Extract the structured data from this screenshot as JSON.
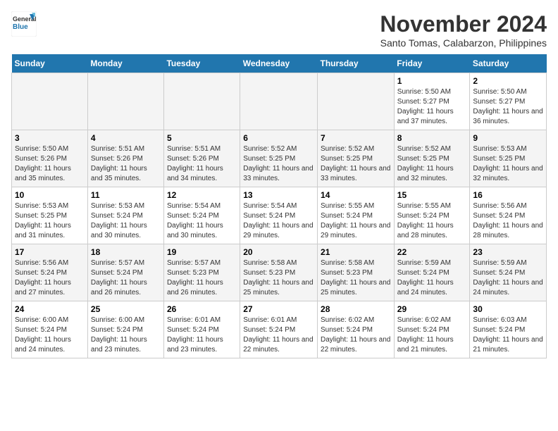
{
  "header": {
    "logo_line1": "General",
    "logo_line2": "Blue",
    "month_year": "November 2024",
    "location": "Santo Tomas, Calabarzon, Philippines"
  },
  "weekdays": [
    "Sunday",
    "Monday",
    "Tuesday",
    "Wednesday",
    "Thursday",
    "Friday",
    "Saturday"
  ],
  "weeks": [
    [
      {
        "day": "",
        "info": ""
      },
      {
        "day": "",
        "info": ""
      },
      {
        "day": "",
        "info": ""
      },
      {
        "day": "",
        "info": ""
      },
      {
        "day": "",
        "info": ""
      },
      {
        "day": "1",
        "info": "Sunrise: 5:50 AM\nSunset: 5:27 PM\nDaylight: 11 hours and 37 minutes."
      },
      {
        "day": "2",
        "info": "Sunrise: 5:50 AM\nSunset: 5:27 PM\nDaylight: 11 hours and 36 minutes."
      }
    ],
    [
      {
        "day": "3",
        "info": "Sunrise: 5:50 AM\nSunset: 5:26 PM\nDaylight: 11 hours and 35 minutes."
      },
      {
        "day": "4",
        "info": "Sunrise: 5:51 AM\nSunset: 5:26 PM\nDaylight: 11 hours and 35 minutes."
      },
      {
        "day": "5",
        "info": "Sunrise: 5:51 AM\nSunset: 5:26 PM\nDaylight: 11 hours and 34 minutes."
      },
      {
        "day": "6",
        "info": "Sunrise: 5:52 AM\nSunset: 5:25 PM\nDaylight: 11 hours and 33 minutes."
      },
      {
        "day": "7",
        "info": "Sunrise: 5:52 AM\nSunset: 5:25 PM\nDaylight: 11 hours and 33 minutes."
      },
      {
        "day": "8",
        "info": "Sunrise: 5:52 AM\nSunset: 5:25 PM\nDaylight: 11 hours and 32 minutes."
      },
      {
        "day": "9",
        "info": "Sunrise: 5:53 AM\nSunset: 5:25 PM\nDaylight: 11 hours and 32 minutes."
      }
    ],
    [
      {
        "day": "10",
        "info": "Sunrise: 5:53 AM\nSunset: 5:25 PM\nDaylight: 11 hours and 31 minutes."
      },
      {
        "day": "11",
        "info": "Sunrise: 5:53 AM\nSunset: 5:24 PM\nDaylight: 11 hours and 30 minutes."
      },
      {
        "day": "12",
        "info": "Sunrise: 5:54 AM\nSunset: 5:24 PM\nDaylight: 11 hours and 30 minutes."
      },
      {
        "day": "13",
        "info": "Sunrise: 5:54 AM\nSunset: 5:24 PM\nDaylight: 11 hours and 29 minutes."
      },
      {
        "day": "14",
        "info": "Sunrise: 5:55 AM\nSunset: 5:24 PM\nDaylight: 11 hours and 29 minutes."
      },
      {
        "day": "15",
        "info": "Sunrise: 5:55 AM\nSunset: 5:24 PM\nDaylight: 11 hours and 28 minutes."
      },
      {
        "day": "16",
        "info": "Sunrise: 5:56 AM\nSunset: 5:24 PM\nDaylight: 11 hours and 28 minutes."
      }
    ],
    [
      {
        "day": "17",
        "info": "Sunrise: 5:56 AM\nSunset: 5:24 PM\nDaylight: 11 hours and 27 minutes."
      },
      {
        "day": "18",
        "info": "Sunrise: 5:57 AM\nSunset: 5:24 PM\nDaylight: 11 hours and 26 minutes."
      },
      {
        "day": "19",
        "info": "Sunrise: 5:57 AM\nSunset: 5:23 PM\nDaylight: 11 hours and 26 minutes."
      },
      {
        "day": "20",
        "info": "Sunrise: 5:58 AM\nSunset: 5:23 PM\nDaylight: 11 hours and 25 minutes."
      },
      {
        "day": "21",
        "info": "Sunrise: 5:58 AM\nSunset: 5:23 PM\nDaylight: 11 hours and 25 minutes."
      },
      {
        "day": "22",
        "info": "Sunrise: 5:59 AM\nSunset: 5:24 PM\nDaylight: 11 hours and 24 minutes."
      },
      {
        "day": "23",
        "info": "Sunrise: 5:59 AM\nSunset: 5:24 PM\nDaylight: 11 hours and 24 minutes."
      }
    ],
    [
      {
        "day": "24",
        "info": "Sunrise: 6:00 AM\nSunset: 5:24 PM\nDaylight: 11 hours and 24 minutes."
      },
      {
        "day": "25",
        "info": "Sunrise: 6:00 AM\nSunset: 5:24 PM\nDaylight: 11 hours and 23 minutes."
      },
      {
        "day": "26",
        "info": "Sunrise: 6:01 AM\nSunset: 5:24 PM\nDaylight: 11 hours and 23 minutes."
      },
      {
        "day": "27",
        "info": "Sunrise: 6:01 AM\nSunset: 5:24 PM\nDaylight: 11 hours and 22 minutes."
      },
      {
        "day": "28",
        "info": "Sunrise: 6:02 AM\nSunset: 5:24 PM\nDaylight: 11 hours and 22 minutes."
      },
      {
        "day": "29",
        "info": "Sunrise: 6:02 AM\nSunset: 5:24 PM\nDaylight: 11 hours and 21 minutes."
      },
      {
        "day": "30",
        "info": "Sunrise: 6:03 AM\nSunset: 5:24 PM\nDaylight: 11 hours and 21 minutes."
      }
    ]
  ]
}
